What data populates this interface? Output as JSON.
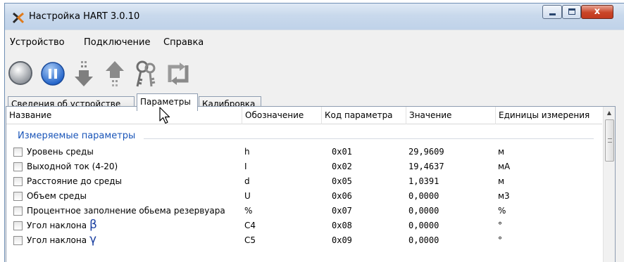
{
  "window": {
    "title": "Настройка HART 3.0.10",
    "close_glyph": "x"
  },
  "menu": [
    {
      "label": "Устройство"
    },
    {
      "label": "Подключение"
    },
    {
      "label": "Справка"
    }
  ],
  "toolbar": [
    {
      "icon": "magnifier-icon"
    },
    {
      "icon": "pause-icon"
    },
    {
      "icon": "download-arrow-icon"
    },
    {
      "icon": "upload-arrow-icon"
    },
    {
      "icon": "keys-icon"
    },
    {
      "icon": "refresh-icon"
    }
  ],
  "tabs": [
    {
      "label": "Сведения об устройстве",
      "active": false
    },
    {
      "label": "Параметры",
      "active": true
    },
    {
      "label": "Калибровка",
      "active": false
    }
  ],
  "table": {
    "headers": [
      "Название",
      "Обозначение",
      "Код параметра",
      "Значение",
      "Единицы измерения"
    ],
    "group": "Измеряемые параметры",
    "rows": [
      {
        "name": "Уровень среды",
        "symbol": "h",
        "code": "0x01",
        "value": "29,9609",
        "unit": "м"
      },
      {
        "name": "Выходной ток (4-20)",
        "symbol": "I",
        "code": "0x02",
        "value": "19,4637",
        "unit": "мА"
      },
      {
        "name": "Расстояние до среды",
        "symbol": "d",
        "code": "0x05",
        "value": "1,0391",
        "unit": "м"
      },
      {
        "name": "Объем среды",
        "symbol": "U",
        "code": "0x06",
        "value": "0,0000",
        "unit": "м3"
      },
      {
        "name": "Процентное заполнение обьема резервуара",
        "symbol": "%",
        "code": "0x07",
        "value": "0,0000",
        "unit": "%"
      },
      {
        "name": "Угол наклона",
        "greek": "β",
        "symbol": "C4",
        "code": "0x08",
        "value": "0,0000",
        "unit": "°"
      },
      {
        "name": "Угол наклона",
        "greek": "γ",
        "symbol": "C5",
        "code": "0x09",
        "value": "0,0000",
        "unit": "°"
      }
    ]
  },
  "scrollbar": {
    "up": "▲",
    "grip": "≡"
  }
}
